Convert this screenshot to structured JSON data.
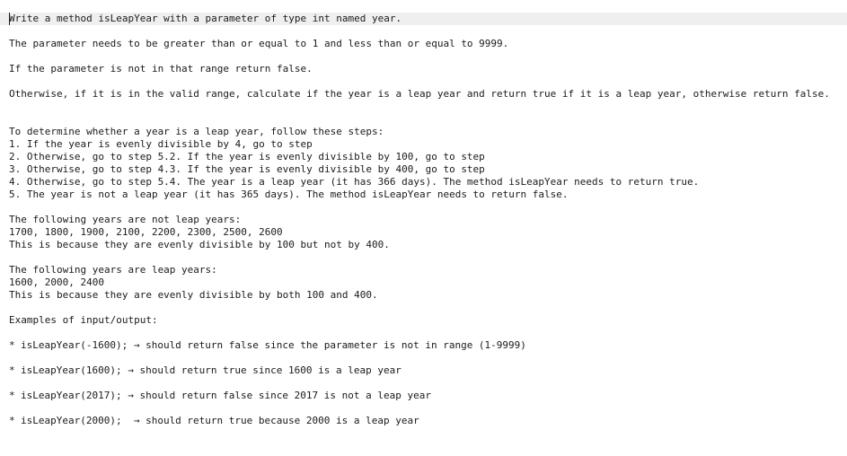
{
  "intro": [
    "Write a method isLeapYear with a parameter of type int named year.",
    "The parameter needs to be greater than or equal to 1 and less than or equal to 9999.",
    "If the parameter is not in that range return false.",
    "Otherwise, if it is in the valid range, calculate if the year is a leap year and return true if it is a leap year, otherwise return false."
  ],
  "steps_intro": "To determine whether a year is a leap year, follow these steps:",
  "steps": [
    "1. If the year is evenly divisible by 4, go to step",
    "2. Otherwise, go to step 5.2. If the year is evenly divisible by 100, go to step",
    "3. Otherwise, go to step 4.3. If the year is evenly divisible by 400, go to step",
    "4. Otherwise, go to step 5.4. The year is a leap year (it has 366 days). The method isLeapYear needs to return true.",
    "5. The year is not a leap year (it has 365 days). The method isLeapYear needs to return false."
  ],
  "not_leap": {
    "heading": "The following years are not leap years:",
    "years": "1700, 1800, 1900, 2100, 2200, 2300, 2500, 2600",
    "reason": "This is because they are evenly divisible by 100 but not by 400."
  },
  "leap": {
    "heading": "The following years are leap years:",
    "years": "1600, 2000, 2400",
    "reason": "This is because they are evenly divisible by both 100 and 400."
  },
  "examples_heading": "Examples of input/output:",
  "bullet": "*",
  "examples": [
    "isLeapYear(-1600); → should return false since the parameter is not in range (1-9999)",
    "isLeapYear(1600); → should return true since 1600 is a leap year",
    "isLeapYear(2017); → should return false since 2017 is not a leap year",
    "isLeapYear(2000);  → should return true because 2000 is a leap year"
  ]
}
